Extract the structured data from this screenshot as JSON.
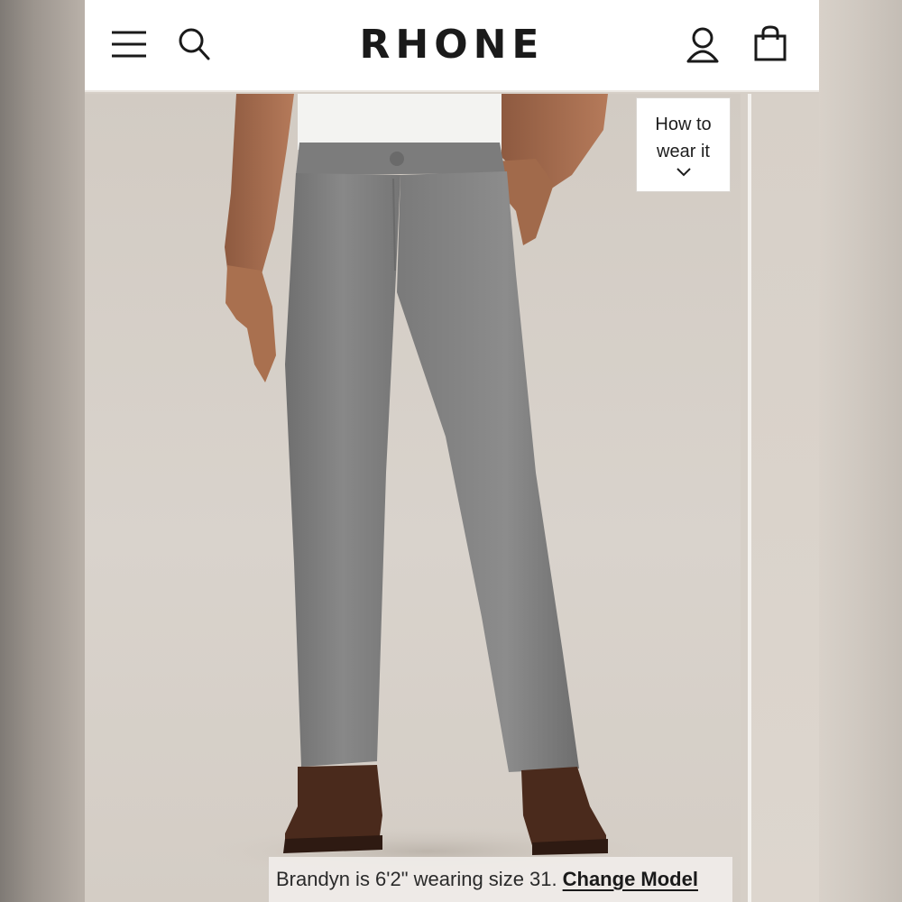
{
  "header": {
    "brand": "RHONE",
    "icons": [
      "menu-icon",
      "search-icon",
      "account-icon",
      "bag-icon"
    ]
  },
  "hero": {
    "image_subject": "gray chino pants on model",
    "how_to_wear": {
      "line1": "How to",
      "line2": "wear it",
      "icon": "chevron-down-icon"
    }
  },
  "caption": {
    "text": "Brandyn is 6'2\" wearing size 31.",
    "link": "Change Model"
  },
  "colors": {
    "header_bg": "#ffffff",
    "pants": "#7d7d7d",
    "shirt": "#f4f4f2",
    "shoes": "#4a2a1c",
    "skin": "#a86c4e",
    "background": "#d6cfc7"
  }
}
